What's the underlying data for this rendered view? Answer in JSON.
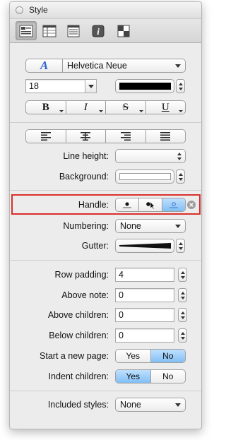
{
  "window": {
    "title": "Style"
  },
  "toolbar": {
    "items": [
      {
        "icon": "style-inspector-icon",
        "active": true
      },
      {
        "icon": "columns-icon",
        "active": false
      },
      {
        "icon": "document-icon",
        "active": false
      },
      {
        "icon": "info-icon",
        "active": false
      },
      {
        "icon": "layout-icon",
        "active": false
      }
    ]
  },
  "font": {
    "family": "Helvetica Neue",
    "size": "18",
    "color": "#000000"
  },
  "text_style_buttons": [
    "B",
    "I",
    "S",
    "U"
  ],
  "alignment_icons": [
    "align-left-icon",
    "align-center-icon",
    "align-right-icon",
    "justify-icon"
  ],
  "labels": {
    "line_height": "Line height:",
    "background": "Background:",
    "handle": "Handle:",
    "numbering": "Numbering:",
    "gutter": "Gutter:",
    "row_padding": "Row padding:",
    "above_note": "Above note:",
    "above_children": "Above children:",
    "below_children": "Below children:",
    "start_new_page": "Start a new page:",
    "indent_children": "Indent children:",
    "included_styles": "Included styles:"
  },
  "values": {
    "numbering": "None",
    "row_padding": "4",
    "above_note": "0",
    "above_children": "0",
    "below_children": "0",
    "included_styles": "None"
  },
  "handle_options": [
    "bullet-handle-icon",
    "bullet-cursor-handle-icon",
    "hollow-handle-icon"
  ],
  "start_new_page": {
    "yes": "Yes",
    "no": "No",
    "selected": "No"
  },
  "indent_children": {
    "yes": "Yes",
    "no": "No",
    "selected": "Yes"
  },
  "highlight_color": "#d9302c",
  "selected_segment_color": "#82bff4"
}
